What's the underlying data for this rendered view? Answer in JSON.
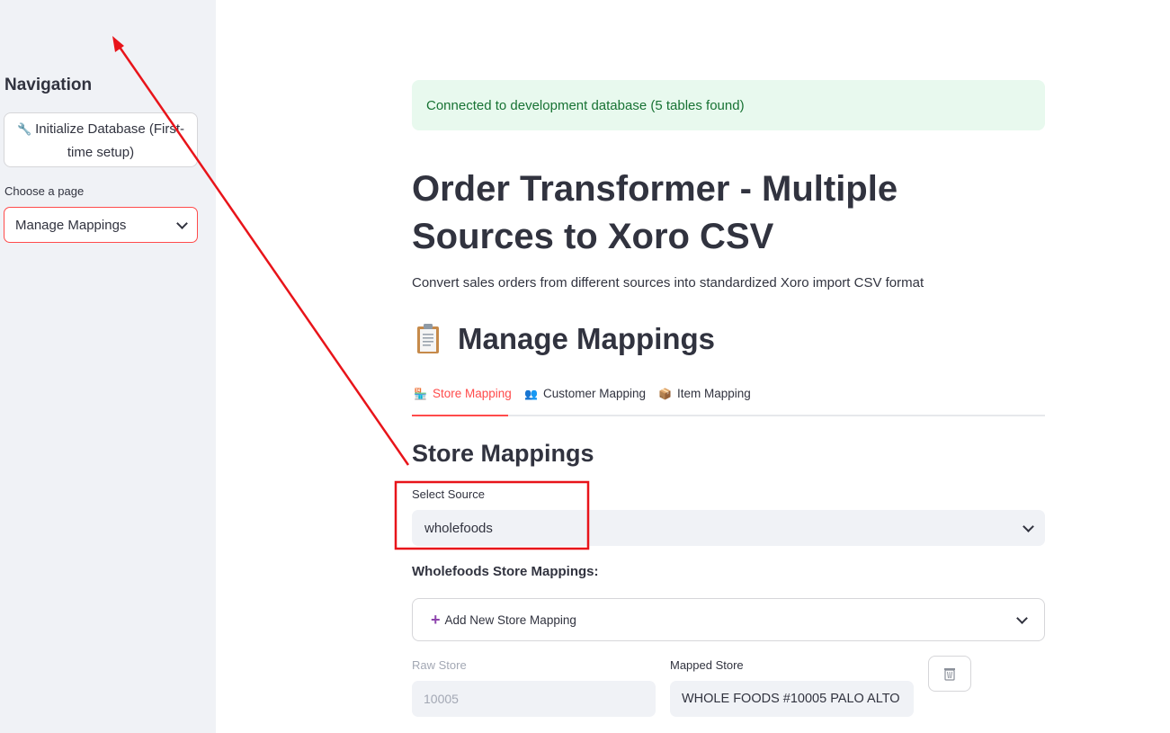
{
  "sidebar": {
    "title": "Navigation",
    "init_button": {
      "icon": "wrench-icon",
      "label": "Initialize Database (First-time setup)"
    },
    "page_label": "Choose a page",
    "page_select_value": "Manage Mappings"
  },
  "main": {
    "alert": "Connected to development database (5 tables found)",
    "title": "Order Transformer - Multiple Sources to Xoro CSV",
    "subtitle": "Convert sales orders from different sources into standardized Xoro import CSV format",
    "section_title": "Manage Mappings",
    "section_icon": "clipboard-icon",
    "tabs": [
      {
        "label": "Store Mapping",
        "icon": "store-icon",
        "active": true
      },
      {
        "label": "Customer Mapping",
        "icon": "people-icon",
        "active": false
      },
      {
        "label": "Item Mapping",
        "icon": "package-icon",
        "active": false
      }
    ],
    "store_mappings": {
      "heading": "Store Mappings",
      "source_label": "Select Source",
      "source_value": "wholefoods",
      "list_label": "Wholefoods Store Mappings:",
      "add_new": "Add New Store Mapping",
      "raw_label": "Raw Store",
      "mapped_label": "Mapped Store",
      "rows": [
        {
          "raw": "10005",
          "mapped": "WHOLE FOODS #10005 PALO ALTO"
        }
      ]
    }
  },
  "colors": {
    "accent": "#ff4b4b",
    "success_bg": "#e8f9ee",
    "success_text": "#177233",
    "annotation": "#e8141a"
  }
}
